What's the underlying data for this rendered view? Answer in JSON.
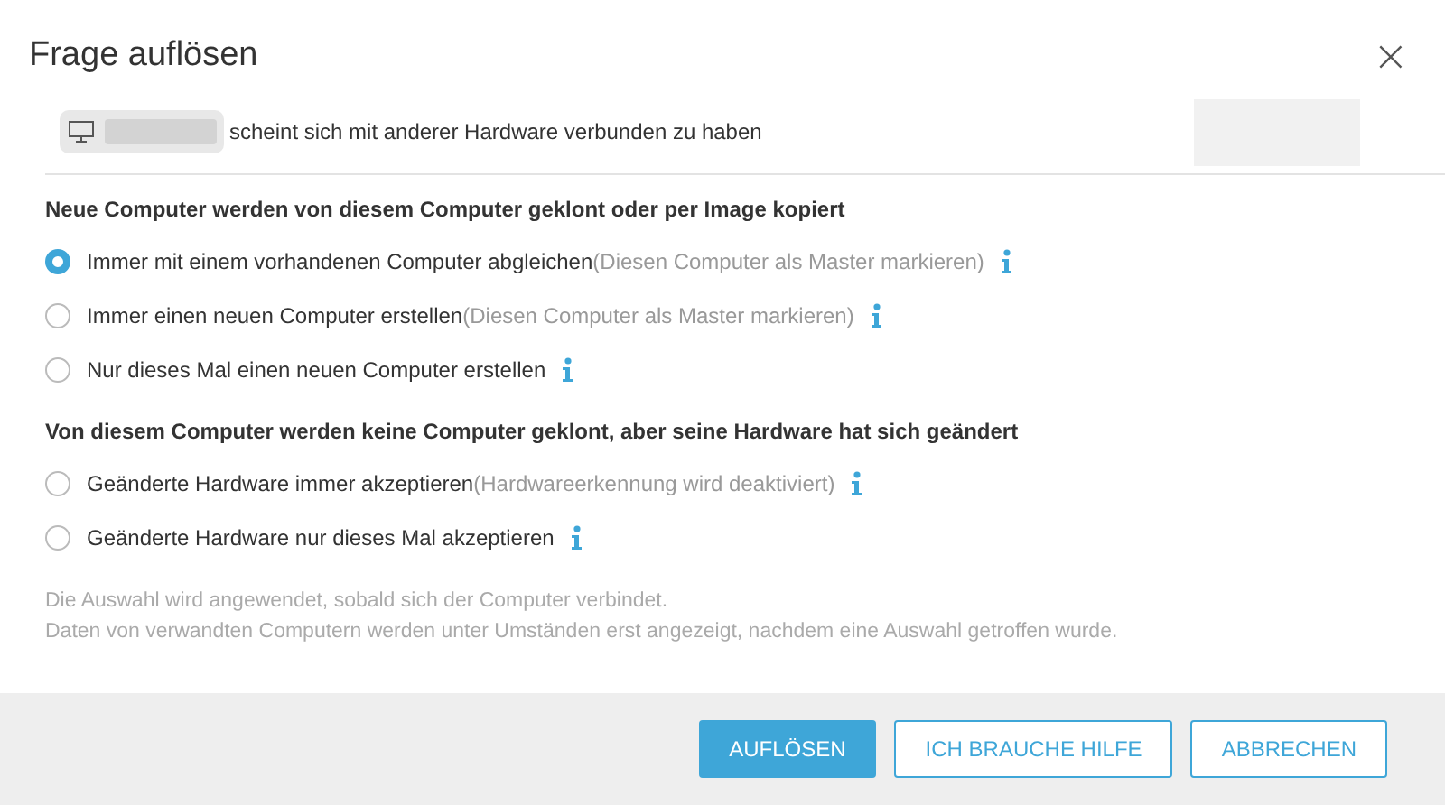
{
  "dialog": {
    "title": "Frage auflösen",
    "close": "×"
  },
  "device": {
    "message": "scheint sich mit anderer Hardware verbunden zu haben"
  },
  "sections": [
    {
      "heading": "Neue Computer werden von diesem Computer geklont oder per Image kopiert",
      "options": [
        {
          "label": "Immer mit einem vorhandenen Computer abgleichen",
          "hint": "(Diesen Computer als Master markieren)",
          "selected": true
        },
        {
          "label": "Immer einen neuen Computer erstellen",
          "hint": "(Diesen Computer als Master markieren)",
          "selected": false
        },
        {
          "label": "Nur dieses Mal einen neuen Computer erstellen",
          "selected": false
        }
      ]
    },
    {
      "heading": "Von diesem Computer werden keine Computer geklont, aber seine Hardware hat sich geändert",
      "options": [
        {
          "label": "Geänderte Hardware immer akzeptieren",
          "hint": "(Hardwareerkennung wird deaktiviert)",
          "selected": false
        },
        {
          "label": "Geänderte Hardware nur dieses Mal akzeptieren",
          "selected": false
        }
      ]
    }
  ],
  "notes": [
    "Die Auswahl wird angewendet, sobald sich der Computer verbindet.",
    "Daten von verwandten Computern werden unter Umständen erst angezeigt, nachdem eine Auswahl getroffen wurde."
  ],
  "buttons": [
    {
      "label": "AUFLÖSEN",
      "kind": "primary"
    },
    {
      "label": "ICH BRAUCHE HILFE",
      "kind": "secondary"
    },
    {
      "label": "ABBRECHEN",
      "kind": "secondary"
    }
  ]
}
